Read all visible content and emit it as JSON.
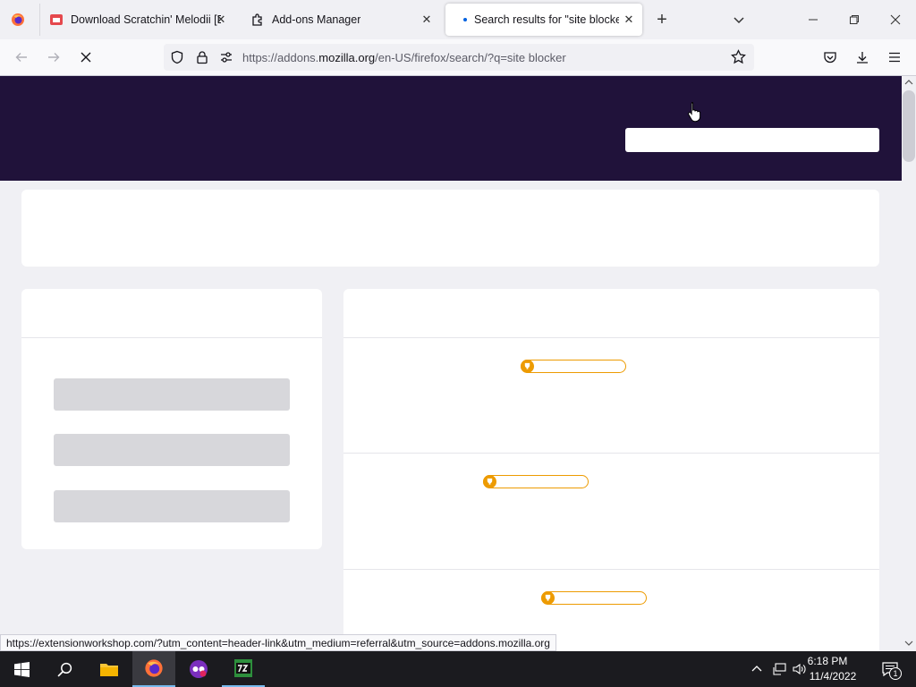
{
  "tabs": [
    {
      "title": "Download Scratchin' Melodii [D",
      "close": "✕"
    },
    {
      "title": "Add-ons Manager",
      "close": "✕"
    },
    {
      "title": "Search results for \"site blocker\"",
      "close": "✕"
    }
  ],
  "new_tab_label": "+",
  "url": {
    "prefix": "https://addons.",
    "host": "mozilla.org",
    "path": "/en-US/firefox/search/?q=site blocker"
  },
  "status_url": "https://extensionworkshop.com/?utm_content=header-link&utm_medium=referral&utm_source=addons.mozilla.org",
  "clock": {
    "time": "6:18 PM",
    "date": "11/4/2022"
  },
  "notification_count": "1",
  "colors": {
    "hero": "#20123a",
    "rating": "#ed9b02",
    "accent": "#0061e0"
  }
}
